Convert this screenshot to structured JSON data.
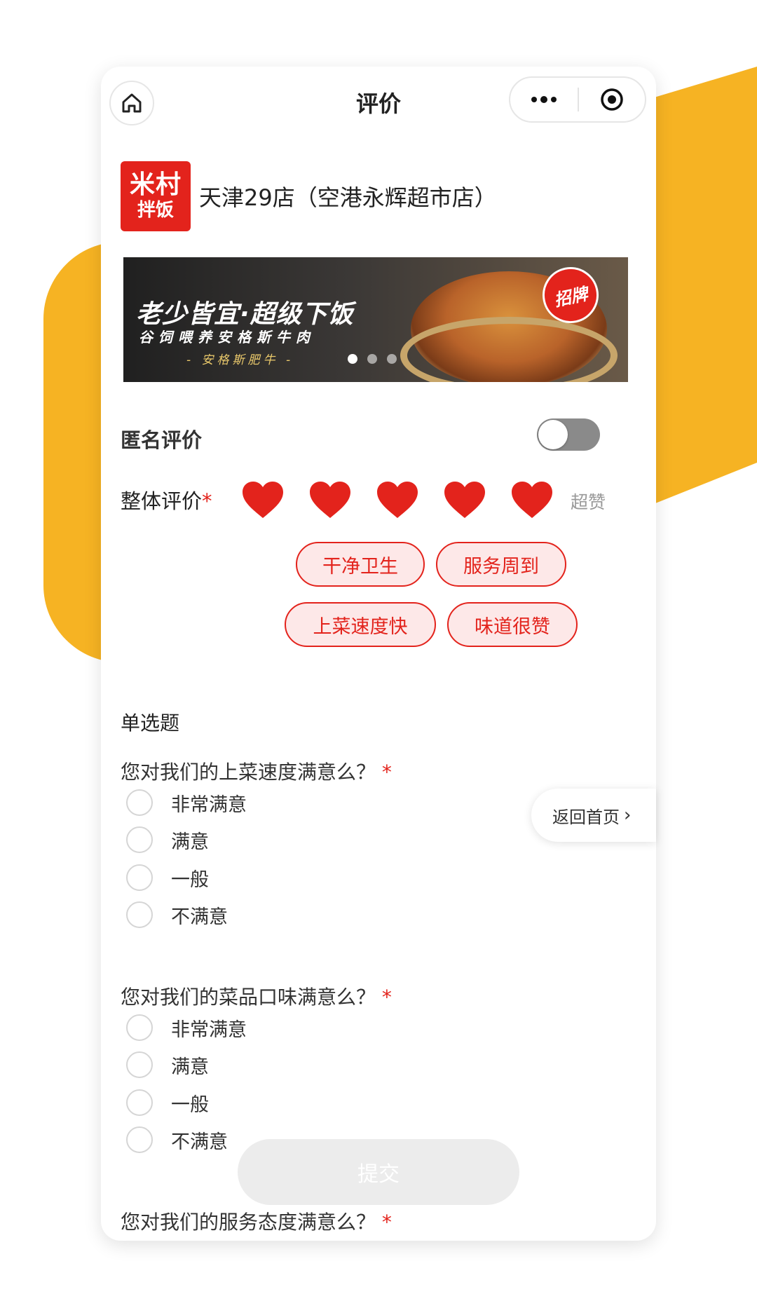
{
  "nav": {
    "title": "评价",
    "home_icon": "home-icon",
    "more_icon": "more-dots-icon",
    "close_icon": "target-close-icon"
  },
  "store": {
    "logo_line1": "米村",
    "logo_line2": "拌饭",
    "name": "天津29店（空港永辉超市店）"
  },
  "banner": {
    "headline": "老少皆宜·超级下饭",
    "subline": "谷饲喂养安格斯牛肉",
    "tagline": "- 安格斯肥牛 -",
    "badge": "招牌",
    "slides": 3,
    "active_slide": 1
  },
  "anonymous": {
    "label": "匿名评价",
    "enabled": false
  },
  "overall": {
    "label": "整体评价",
    "required_mark": "*",
    "rating": 5,
    "max_rating": 5,
    "rating_text": "超赞",
    "heart_color": "#E3231C"
  },
  "tags": [
    "干净卫生",
    "服务周到",
    "上菜速度快",
    "味道很赞"
  ],
  "section": {
    "title": "单选题"
  },
  "questions": [
    {
      "text": "您对我们的上菜速度满意么？",
      "required_mark": "*",
      "options": [
        "非常满意",
        "满意",
        "一般",
        "不满意"
      ]
    },
    {
      "text": "您对我们的菜品口味满意么？",
      "required_mark": "*",
      "options": [
        "非常满意",
        "满意",
        "一般",
        "不满意"
      ]
    },
    {
      "text": "您对我们的服务态度满意么？",
      "required_mark": "*",
      "options": []
    }
  ],
  "back_home": {
    "label": "返回首页",
    "chevron": "›"
  },
  "submit": {
    "label": "提交"
  },
  "colors": {
    "accent": "#E3231C",
    "decor": "#F6B323"
  }
}
